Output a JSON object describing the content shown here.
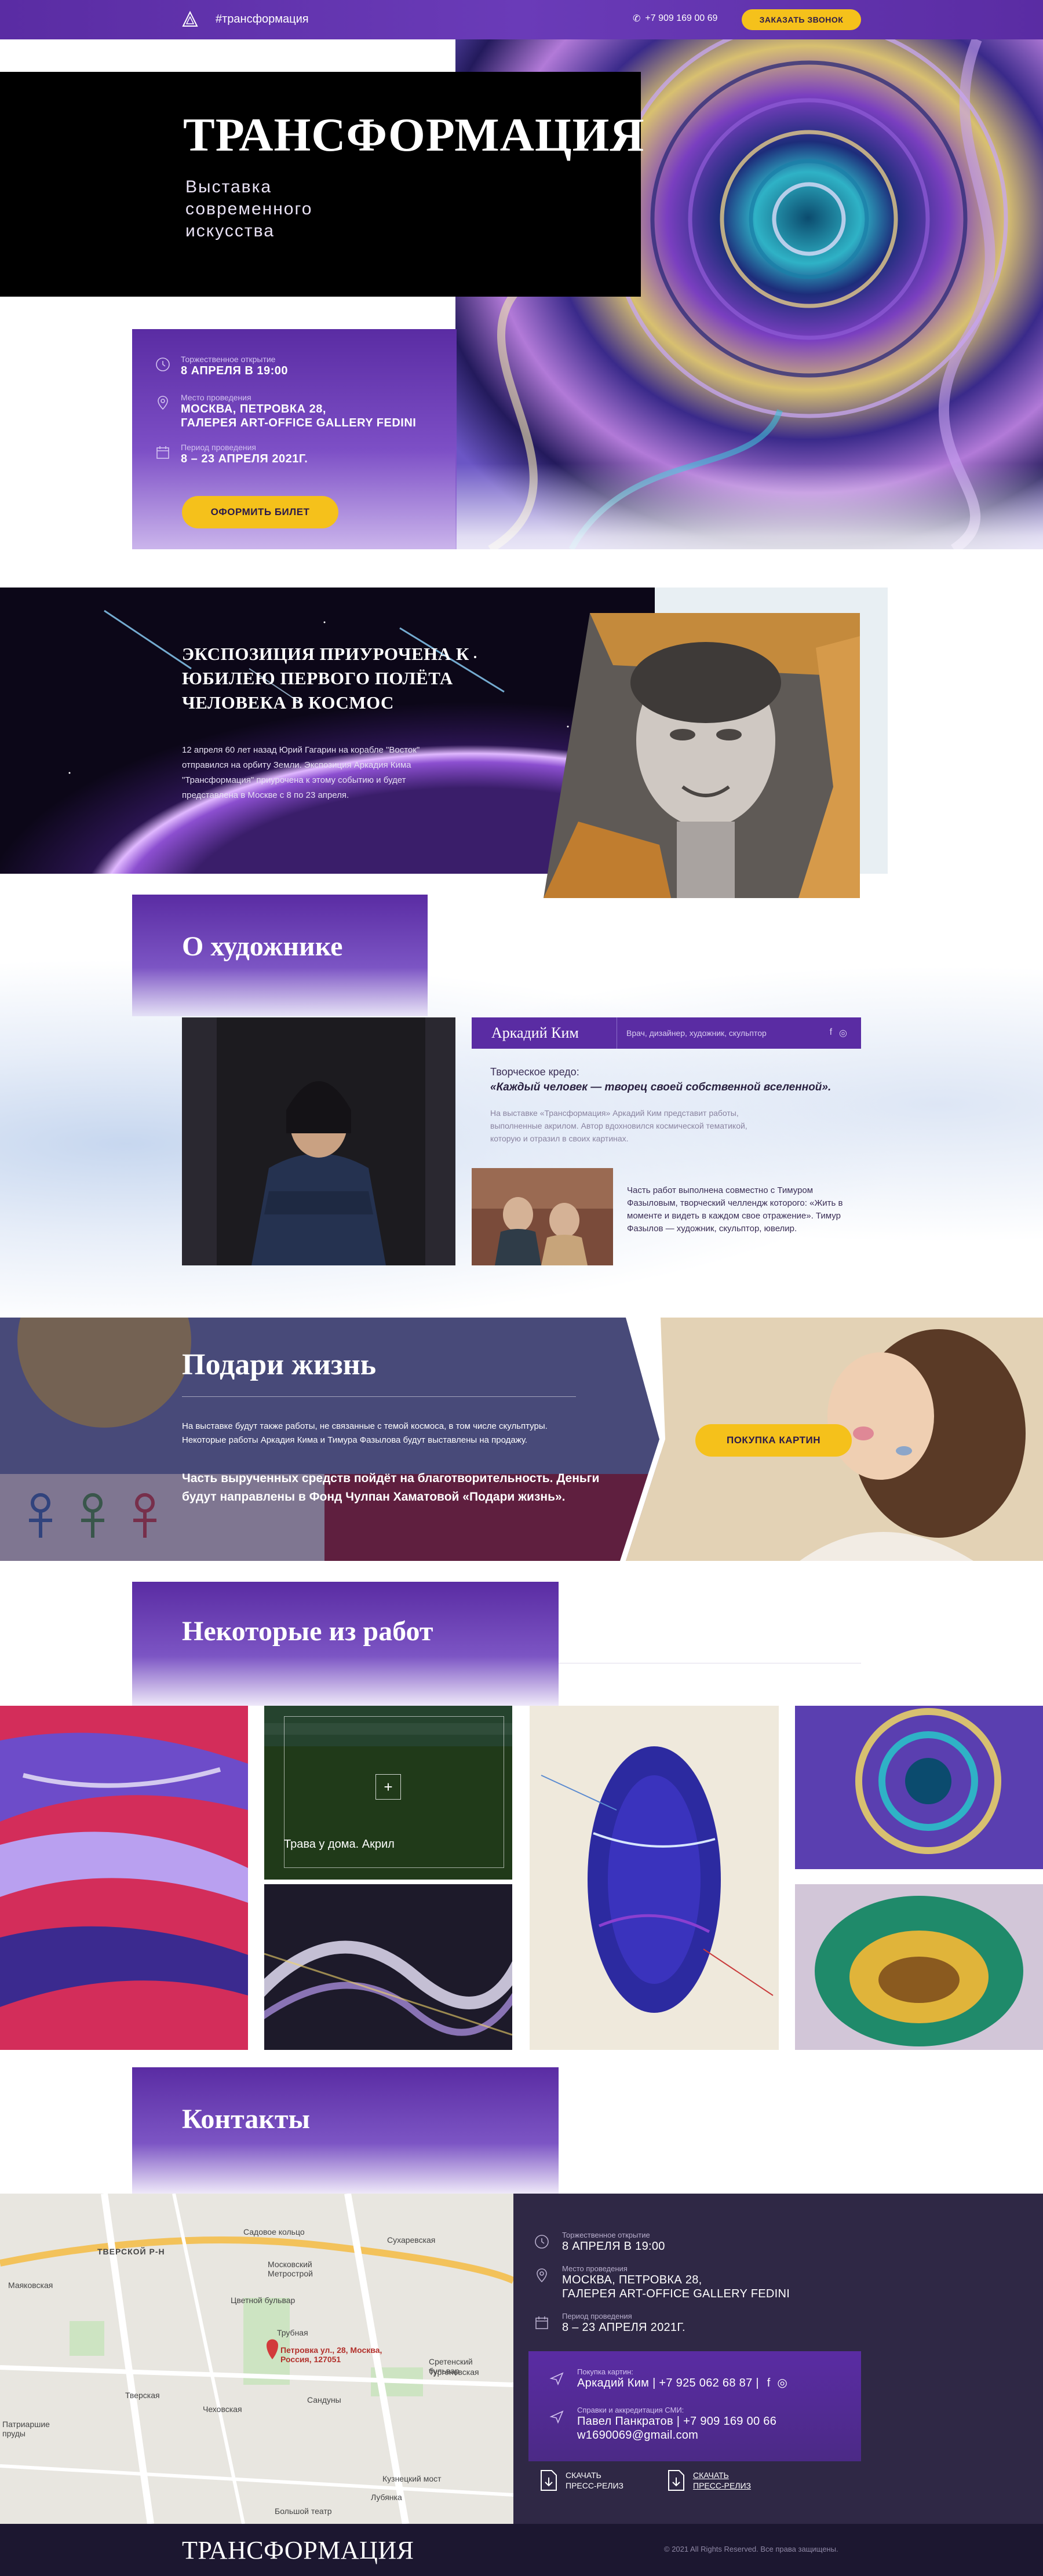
{
  "nav": {
    "tag": "#трансформация",
    "phone": "+7 909 169 00 69",
    "call_button": "ЗАКАЗАТЬ ЗВОНОК"
  },
  "hero": {
    "title": "ТРАНСФОРМАЦИЯ",
    "subtitle": "Выставка современного искусства",
    "opening_label": "Торжественное открытие",
    "opening_value": "8 АПРЕЛЯ В 19:00",
    "venue_label": "Место проведения",
    "venue_value_1": "МОСКВА, ПЕТРОВКА 28,",
    "venue_value_2": "ГАЛЕРЕЯ ART-OFFICE GALLERY FEDINI",
    "period_label": "Период проведения",
    "period_value": "8 – 23 АПРЕЛЯ 2021Г.",
    "ticket_button": "ОФОРМИТЬ БИЛЕТ"
  },
  "gagarin": {
    "title": "ЭКСПОЗИЦИЯ ПРИУРОЧЕНА К ЮБИЛЕЮ ПЕРВОГО ПОЛЁТА ЧЕЛОВЕКА В КОСМОС",
    "text": "12 апреля 60 лет назад Юрий Гагарин на корабле \"Восток\" отправился на орбиту Земли. Экспозиция Аркадия Кима \"Трансформация\" приурочена к этому событию и будет представлена в Москве с 8 по 23 апреля."
  },
  "about": {
    "title": "О художнике",
    "name": "Аркадий Ким",
    "role": "Врач, дизайнер, художник, скульптор",
    "credo_label": "Творческое кредо:",
    "credo_quote": "«Каждый человек — творец своей собственной вселенной».",
    "desc": "На выставке «Трансформация» Аркадий Ким представит работы, выполненные акрилом. Автор вдохновился космической тематикой, которую и отразил в своих картинах.",
    "duo_text": "Часть работ выполнена совместно с Тимуром Фазыловым, творческий челлендж которого: «Жить в моменте и видеть в каждом свое отражение». Тимур Фазылов — художник, скульптор, ювелир."
  },
  "charity": {
    "title": "Подари жизнь",
    "text": "На выставке будут также работы, не связанные с темой космоса, в том числе скульптуры. Некоторые работы Аркадия Кима и Тимура Фазылова будут выставлены на продажу.",
    "bold": "Часть вырученных средств пойдёт на благотворительность. Деньги будут направлены в Фонд Чулпан Хаматовой «Подари жизнь».",
    "button": "ПОКУПКА КАРТИН"
  },
  "works": {
    "title": "Некоторые из работ",
    "hover_caption": "Трава у дома. Акрил",
    "hover_plus": "+"
  },
  "contacts": {
    "title": "Контакты",
    "opening_label": "Торжественное открытие",
    "opening_value": "8 АПРЕЛЯ В 19:00",
    "venue_label": "Место проведения",
    "venue_value_1": "МОСКВА, ПЕТРОВКА 28,",
    "venue_value_2": "ГАЛЕРЕЯ ART-OFFICE GALLERY FEDINI",
    "period_label": "Период проведения",
    "period_value": "8 – 23 АПРЕЛЯ 2021Г.",
    "buy_label": "Покупка картин:",
    "buy_value": "Аркадий Ким  |  +7 925 062 68 87  |",
    "press_label": "Справки и аккредитация СМИ:",
    "press_value": "Павел Панкратов  |  +7 909 169 00 66",
    "press_email": "w1690069@gmail.com",
    "download_1": "СКАЧАТЬ ПРЕСС-РЕЛИЗ",
    "download_2": "СКАЧАТЬ ПРЕСС-РЕЛИЗ",
    "map_labels": {
      "district": "ТВЕРСКОЙ Р-Н",
      "sadovoe": "Садовое кольцо",
      "sukharevskaya": "Сухаревская",
      "mayakovskaya": "Маяковская",
      "moskovsky_metrostroy": "Московский Метрострой",
      "tsvetnoy": "Цветной бульвар",
      "trubnaya": "Трубная",
      "petrovka": "Петровка ул., 28, Москва, Россия, 127051",
      "sretensky": "Сретенский бульвар",
      "turgenevskaya": "Тургеневская",
      "tverskaya": "Тверская",
      "chekhovskaya": "Чеховская",
      "sandunyi": "Сандуны",
      "patriarshie": "Патриаршие пруды",
      "kuznetsky": "Кузнецкий мост",
      "bolshoy": "Большой театр",
      "lubyanka": "Лубянка"
    }
  },
  "footer": {
    "logo": "ТРАНСФОРМАЦИЯ",
    "copy": "© 2021 All Rights Reserved. Все права защищены."
  },
  "colors": {
    "purple": "#5a2ca3",
    "yellow": "#f5c11b",
    "dark": "#2f2845"
  }
}
